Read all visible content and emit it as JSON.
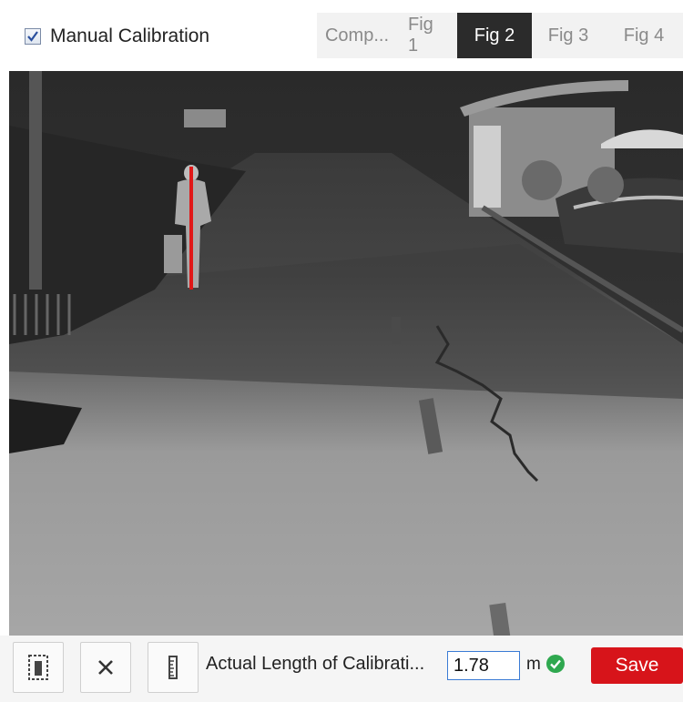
{
  "header": {
    "manual_calibration": {
      "label": "Manual Calibration",
      "checked": true
    },
    "tabs": [
      {
        "label": "Comp...",
        "active": false
      },
      {
        "label": "Fig 1",
        "active": false
      },
      {
        "label": "Fig 2",
        "active": true
      },
      {
        "label": "Fig 3",
        "active": false
      },
      {
        "label": "Fig 4",
        "active": false
      }
    ]
  },
  "toolbar": {
    "tools": [
      {
        "icon": "calibration-draw-icon"
      },
      {
        "icon": "close-icon"
      },
      {
        "icon": "ruler-icon"
      }
    ],
    "length_label": "Actual Length of Calibrati...",
    "length_value": "1.78",
    "unit": "m",
    "valid_icon": "check-circle-icon",
    "save_label": "Save"
  },
  "colors": {
    "accent_save": "#d7141a",
    "active_tab": "#2b2b2b",
    "valid_green": "#2fa84f",
    "calibration_line": "#e01818"
  }
}
